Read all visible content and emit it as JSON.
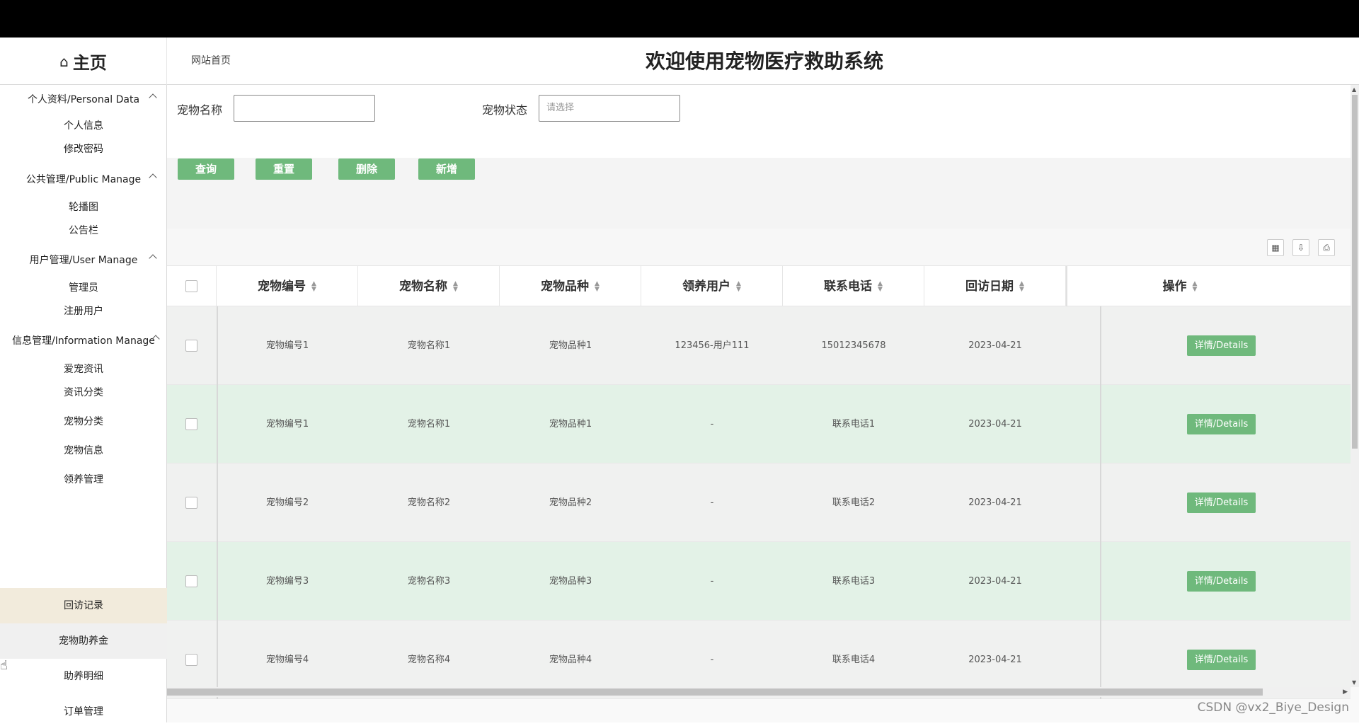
{
  "header": {
    "home_icon": "home-icon",
    "home_label": "主页",
    "breadcrumb": "网站首页",
    "site_title": "欢迎使用宠物医疗救助系统"
  },
  "sidebar": {
    "groups": [
      {
        "title": "个人资料/Personal Data",
        "items": [
          "个人信息",
          "修改密码"
        ]
      },
      {
        "title": "公共管理/Public Manage",
        "items": [
          "轮播图",
          "公告栏"
        ]
      },
      {
        "title": "用户管理/User Manage",
        "items": [
          "管理员",
          "注册用户"
        ]
      },
      {
        "title": "信息管理/Information Manage",
        "items": [
          "爱宠资讯",
          "资讯分类",
          "宠物分类",
          "宠物信息",
          "领养管理",
          "回访记录",
          "宠物助养金",
          "助养明细",
          "订单管理"
        ]
      }
    ],
    "active_item": "回访记录"
  },
  "search": {
    "pet_name_label": "宠物名称",
    "pet_name_value": "",
    "pet_status_label": "宠物状态",
    "pet_status_placeholder": "请选择"
  },
  "buttons": {
    "query": "查询",
    "reset": "重置",
    "delete": "删除",
    "add": "新增"
  },
  "toolbar_icons": [
    "columns-icon",
    "export-icon",
    "print-icon"
  ],
  "table": {
    "columns": [
      "宠物编号",
      "宠物名称",
      "宠物品种",
      "领养用户",
      "联系电话",
      "回访日期",
      "操作"
    ],
    "rows": [
      {
        "id": "宠物编号1",
        "name": "宠物名称1",
        "breed": "宠物品种1",
        "user": "123456-用户111",
        "phone": "15012345678",
        "date": "2023-04-21",
        "action": "详情/Details"
      },
      {
        "id": "宠物编号1",
        "name": "宠物名称1",
        "breed": "宠物品种1",
        "user": "-",
        "phone": "联系电话1",
        "date": "2023-04-21",
        "action": "详情/Details"
      },
      {
        "id": "宠物编号2",
        "name": "宠物名称2",
        "breed": "宠物品种2",
        "user": "-",
        "phone": "联系电话2",
        "date": "2023-04-21",
        "action": "详情/Details"
      },
      {
        "id": "宠物编号3",
        "name": "宠物名称3",
        "breed": "宠物品种3",
        "user": "-",
        "phone": "联系电话3",
        "date": "2023-04-21",
        "action": "详情/Details"
      },
      {
        "id": "宠物编号4",
        "name": "宠物名称4",
        "breed": "宠物品种4",
        "user": "-",
        "phone": "联系电话4",
        "date": "2023-04-21",
        "action": "详情/Details"
      }
    ]
  },
  "watermark": "CSDN @vx2_Biye_Design",
  "colors": {
    "button_green": "#6fb97c",
    "row_even": "#e3f2e7",
    "row_odd": "#f0f1f0",
    "active_menu": "#f2ebdc"
  }
}
